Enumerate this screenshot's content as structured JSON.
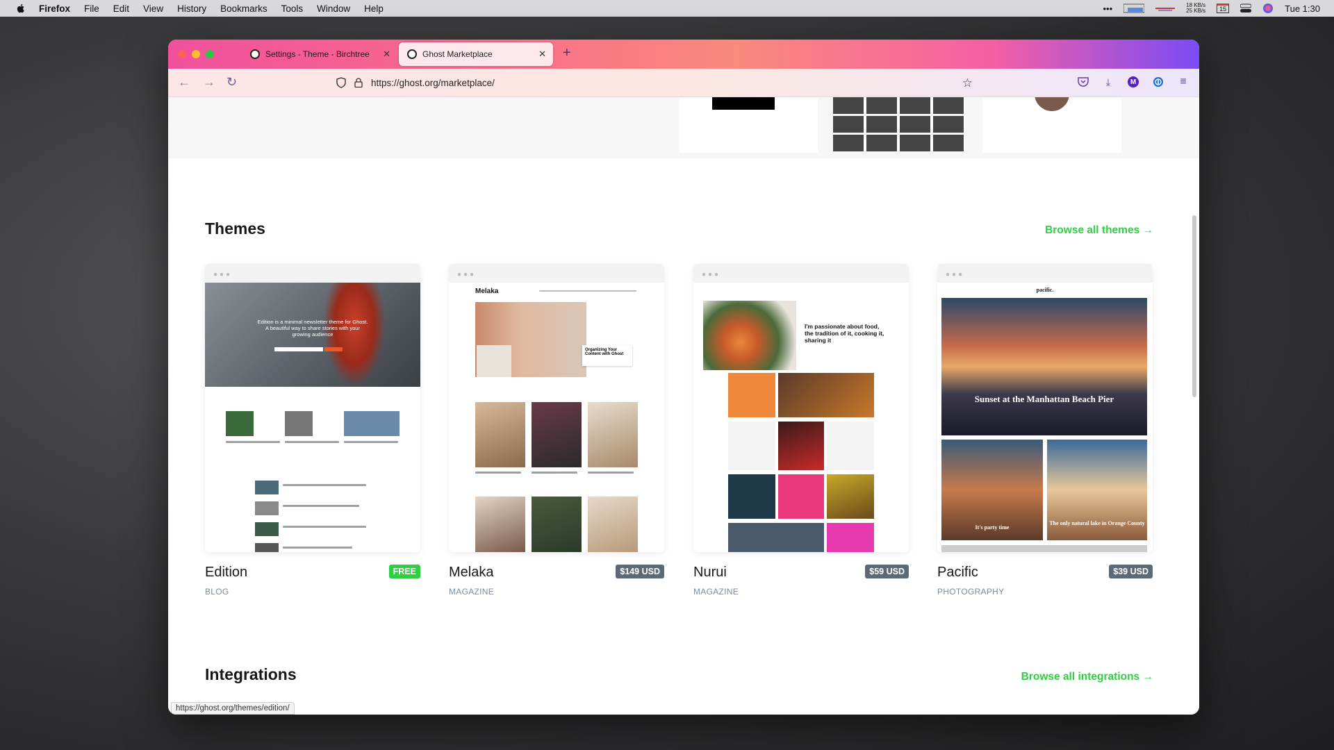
{
  "menubar": {
    "app": "Firefox",
    "items": [
      "File",
      "Edit",
      "View",
      "History",
      "Bookmarks",
      "Tools",
      "Window",
      "Help"
    ],
    "net_up": "18 KB/s",
    "net_down": "25 KB/s",
    "calendar_day": "15",
    "clock": "Tue 1:30"
  },
  "browser": {
    "tabs": [
      {
        "title": "Settings - Theme - Birchtree",
        "active": false
      },
      {
        "title": "Ghost Marketplace",
        "active": true
      }
    ],
    "url": "https://ghost.org/marketplace/",
    "profile_initial": "M",
    "status_url": "https://ghost.org/themes/edition/"
  },
  "themes_section": {
    "title": "Themes",
    "browse_label": "Browse all themes →",
    "items": [
      {
        "name": "Edition",
        "category": "BLOG",
        "price": "FREE",
        "preview": {
          "hero_text": "Edition is a minimal newsletter theme for Ghost. A beautiful way to share stories with your growing audience"
        }
      },
      {
        "name": "Melaka",
        "category": "MAGAZINE",
        "price": "$149 USD",
        "preview": {
          "logo": "Melaka",
          "card_text": "Organizing Your Content with Ghost"
        }
      },
      {
        "name": "Nurui",
        "category": "MAGAZINE",
        "price": "$59 USD",
        "preview": {
          "headline": "I'm passionate about food, the tradition of it, cooking it, sharing it"
        }
      },
      {
        "name": "Pacific",
        "category": "PHOTOGRAPHY",
        "price": "$39 USD",
        "preview": {
          "logo": "pacific.",
          "hero_title": "Sunset at the Manhattan Beach Pier",
          "tile1": "It's party time",
          "tile2": "The only natural lake in Orange County"
        }
      }
    ]
  },
  "integrations_section": {
    "title": "Integrations",
    "browse_label": "Browse all integrations →"
  },
  "colors": {
    "accent_green": "#30cf43",
    "price_badge": "#5c6a78",
    "tab_gradient_start": "#f1509c",
    "tab_gradient_end": "#7a4bf5"
  }
}
